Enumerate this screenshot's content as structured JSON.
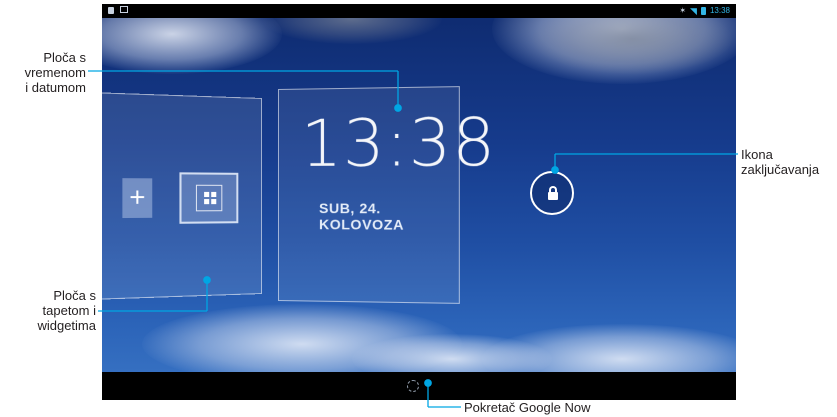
{
  "status_bar": {
    "time": "13:38"
  },
  "lockscreen": {
    "clock_time": "13:38",
    "clock_date": "SUB, 24. KOLOVOZA"
  },
  "callouts": {
    "clock_panel": [
      "Ploča s",
      "vremenom",
      "i datumom"
    ],
    "wallpaper_panel": [
      "Ploča s",
      "tapetom i",
      "widgetima"
    ],
    "lock_icon": [
      "Ikona",
      "zaključavanja"
    ],
    "google_now": "Pokretač Google Now"
  },
  "colors": {
    "callout_line": "#00a6e4",
    "status_accent": "#33b5e5"
  },
  "icons": {
    "add": "plus-icon",
    "widgets": "widgets-icon",
    "lock": "lock-icon",
    "google_now": "google-now-icon",
    "wifi": "wifi-icon",
    "battery": "battery-icon",
    "bluetooth": "bluetooth-icon"
  }
}
